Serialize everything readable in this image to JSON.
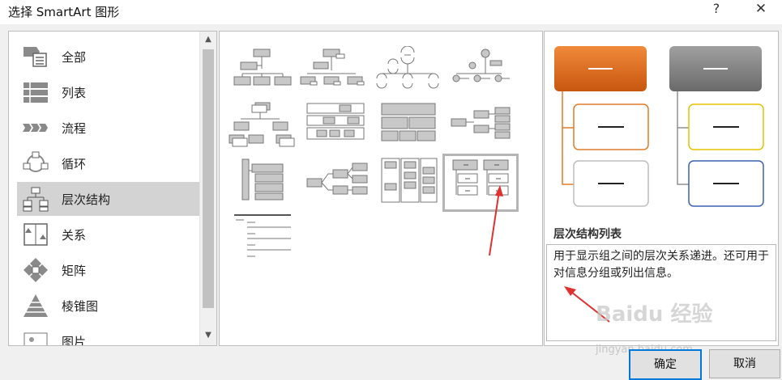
{
  "window": {
    "title": "选择 SmartArt 图形",
    "help": "?",
    "close": "✕"
  },
  "categories": [
    {
      "label": "全部",
      "icon": "all-icon"
    },
    {
      "label": "列表",
      "icon": "list-icon"
    },
    {
      "label": "流程",
      "icon": "process-icon"
    },
    {
      "label": "循环",
      "icon": "cycle-icon"
    },
    {
      "label": "层次结构",
      "icon": "hierarchy-icon",
      "selected": true
    },
    {
      "label": "关系",
      "icon": "relationship-icon"
    },
    {
      "label": "矩阵",
      "icon": "matrix-icon"
    },
    {
      "label": "棱锥图",
      "icon": "pyramid-icon"
    },
    {
      "label": "图片",
      "icon": "picture-icon"
    }
  ],
  "scroll": {
    "up": "▲",
    "down": "▼"
  },
  "gallery": {
    "selected_index": 11,
    "tile_count": 13
  },
  "preview": {
    "title": "层次结构列表",
    "description": "用于显示组之间的层次关系递进。还可用于对信息分组或列出信息。",
    "colors": {
      "orange": "#d4621a",
      "gray": "#7a7a7a",
      "orange_border": "#e07b2a",
      "yellow_border": "#e6c200",
      "blue_border": "#3a62b0"
    }
  },
  "buttons": {
    "ok": "确定",
    "cancel": "取消"
  },
  "watermark": {
    "brand": "Baidu 经验",
    "url": "jingyan.baidu.com"
  },
  "annotation": {
    "color": "#e03030"
  }
}
